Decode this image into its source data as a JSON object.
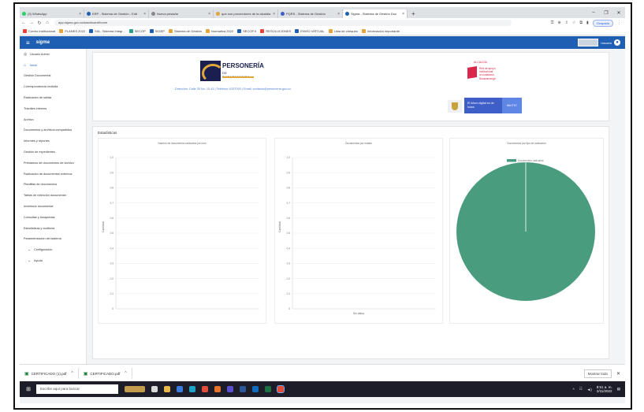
{
  "browser": {
    "tabs": [
      {
        "label": "(3) WhatsApp",
        "color": "#25d366"
      },
      {
        "label": "ERP - Sistema de Gestión - Edit",
        "color": "#1e5fb4"
      },
      {
        "label": "Nueva pestaña",
        "color": "#888888"
      },
      {
        "label": "que son proveedores de la alcaldía",
        "color": "#e2a73c"
      },
      {
        "label": "PQRS - Sistema de Gestión",
        "color": "#3f5fc8"
      },
      {
        "label": "Sigma - Sistema de Gestión Doc",
        "color": "#1e5fb4"
      }
    ],
    "url": "app.sigma.gov.co/dashboard/home",
    "profile_label": "Ocupado",
    "bookmarks": [
      {
        "label": "Correo institucional",
        "color": "#ea4335"
      },
      {
        "label": "PLANES 2022",
        "color": "#e2a73c"
      },
      {
        "label": "SIA - Sistema Integr...",
        "color": "#1e5fb4"
      },
      {
        "label": "SECOP",
        "color": "#2a9d8f"
      },
      {
        "label": "SIGEP",
        "color": "#1e5fb4"
      },
      {
        "label": "Sistema de Gestión",
        "color": "#e2a73c"
      },
      {
        "label": "Normativa 2022",
        "color": "#e2a73c"
      },
      {
        "label": "SECOP II",
        "color": "#1e5fb4"
      },
      {
        "label": "RESOLUCIONES",
        "color": "#ea4335"
      },
      {
        "label": "ENVÍO VIRTUAL",
        "color": "#1e5fb4"
      },
      {
        "label": "Lista de chequeo",
        "color": "#e2a73c"
      },
      {
        "label": "Información importante",
        "color": "#e2a73c"
      }
    ]
  },
  "app": {
    "logo": "sigma",
    "user_name": "Usuario",
    "sidebar": [
      {
        "label": "Usuario Admin",
        "icon": "user-icon",
        "style": ""
      },
      {
        "label": "Inicio",
        "icon": "home-icon",
        "style": "blue"
      },
      {
        "label": "Gestión Documental",
        "icon": "",
        "style": ""
      },
      {
        "label": "Correspondencia recibida",
        "icon": "",
        "style": ""
      },
      {
        "label": "Radicación de salida",
        "icon": "",
        "style": ""
      },
      {
        "label": "Tramites internos",
        "icon": "",
        "style": ""
      },
      {
        "label": "Archivo",
        "icon": "",
        "style": ""
      },
      {
        "label": "Documentos y archivos compartidos",
        "icon": "",
        "style": ""
      },
      {
        "label": "Informes y reportes",
        "icon": "",
        "style": ""
      },
      {
        "label": "Gestión de expedientes",
        "icon": "",
        "style": ""
      },
      {
        "label": "Préstamos de documentos de archivo",
        "icon": "",
        "style": ""
      },
      {
        "label": "Radicación de documentos externos",
        "icon": "",
        "style": ""
      },
      {
        "label": "Plantillas de documentos",
        "icon": "",
        "style": ""
      },
      {
        "label": "Tablas de retención documental",
        "icon": "",
        "style": ""
      },
      {
        "label": "Inventario documental",
        "icon": "",
        "style": ""
      },
      {
        "label": "Consultas y búsquedas",
        "icon": "",
        "style": ""
      },
      {
        "label": "Estadísticas y auditoría",
        "icon": "",
        "style": ""
      },
      {
        "label": "Parametrización del sistema",
        "icon": "",
        "style": ""
      },
      {
        "label": "Configuración",
        "icon": "chevron-down-icon",
        "style": "ind"
      },
      {
        "label": "Ayuda",
        "icon": "chevron-down-icon",
        "style": "ind"
      }
    ],
    "brand": {
      "title": "PERSONERÍA",
      "subtitle": "DE BUCARAMANGA",
      "link": "Dirección: Calle 35 No. 10-43 | Teléfono: 6337000 | Email: contacto@personeria.gov.co"
    },
    "partner": {
      "top": "ALCALDÍA",
      "text": "Red de apoyo\ninstitucional\nal ciudadano\nBucaramanga"
    },
    "gov": {
      "blue_text": "El futuro digital es de todos",
      "light_text": "MinTIC"
    },
    "stats_title": "Estadísticas",
    "charts_panels": {
      "p1_title": "Número de documentos radicados por mes",
      "p2_title": "Documentos por estado",
      "p3_title": "Documentos por tipo de radicación",
      "y_label": "Cantidad",
      "x_label": "Sin datos"
    }
  },
  "chart_data": [
    {
      "type": "line",
      "title": "Número de documentos radicados por mes",
      "ylabel": "Cantidad",
      "xlabel": "",
      "y_ticks": [
        "1.0",
        "0.9",
        "0.8",
        "0.7",
        "0.6",
        "0.5",
        "0.4",
        "0.3",
        "0.2",
        "0.1",
        "0"
      ],
      "ylim": [
        0,
        1
      ],
      "series": []
    },
    {
      "type": "bar",
      "title": "Documentos por estado",
      "ylabel": "Cantidad",
      "xlabel": "Sin datos",
      "y_ticks": [
        "1.0",
        "0.9",
        "0.8",
        "0.7",
        "0.6",
        "0.5",
        "0.4",
        "0.3",
        "0.2",
        "0.1",
        "0"
      ],
      "ylim": [
        0,
        1
      ],
      "categories": [],
      "values": []
    },
    {
      "type": "pie",
      "title": "Documentos por tipo de radicación",
      "legend": [
        "Documentos radicados"
      ],
      "values": [
        100
      ],
      "colors": [
        "#4a9c7e"
      ]
    }
  ],
  "downloads": [
    {
      "label": "CERTIFICADO (1).pdf"
    },
    {
      "label": "CERTIFICADO.pdf"
    }
  ],
  "downloads_show_all": "Mostrar todo",
  "taskbar": {
    "search_placeholder": "Escribe aquí para buscar",
    "time": "8:51 a. m.",
    "date": "2/11/2022"
  }
}
